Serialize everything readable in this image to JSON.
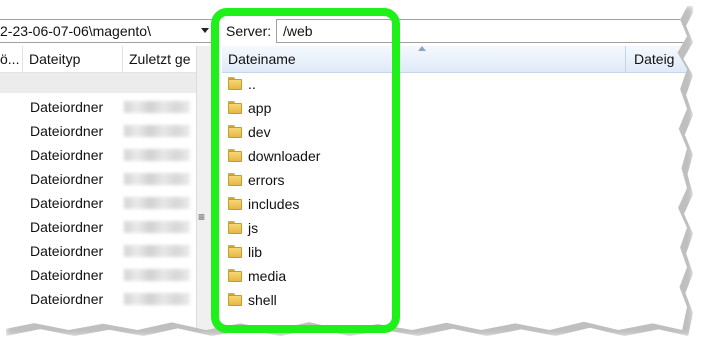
{
  "local": {
    "path": "2-23-06-07-06\\magento\\",
    "columns": {
      "col0": "ö...",
      "col1": "Dateityp",
      "col2": "Zuletzt ge"
    },
    "rows": [
      {
        "type": "Dateiordner"
      },
      {
        "type": "Dateiordner"
      },
      {
        "type": "Dateiordner"
      },
      {
        "type": "Dateiordner"
      },
      {
        "type": "Dateiordner"
      },
      {
        "type": "Dateiordner"
      },
      {
        "type": "Dateiordner"
      },
      {
        "type": "Dateiordner"
      },
      {
        "type": "Dateiordner"
      }
    ]
  },
  "remote": {
    "server_label": "Server:",
    "path": "/web",
    "columns": {
      "name": "Dateiname",
      "col2": "Dateig"
    },
    "items": [
      {
        "name": "..",
        "icon": "folder-icon"
      },
      {
        "name": "app",
        "icon": "folder-icon"
      },
      {
        "name": "dev",
        "icon": "folder-icon"
      },
      {
        "name": "downloader",
        "icon": "folder-icon"
      },
      {
        "name": "errors",
        "icon": "folder-icon"
      },
      {
        "name": "includes",
        "icon": "folder-icon"
      },
      {
        "name": "js",
        "icon": "folder-icon"
      },
      {
        "name": "lib",
        "icon": "folder-icon"
      },
      {
        "name": "media",
        "icon": "folder-icon"
      },
      {
        "name": "shell",
        "icon": "folder-icon"
      }
    ]
  },
  "annotation": {
    "highlight_color": "#1ef01a"
  },
  "splitter": {
    "grip": "≡"
  }
}
